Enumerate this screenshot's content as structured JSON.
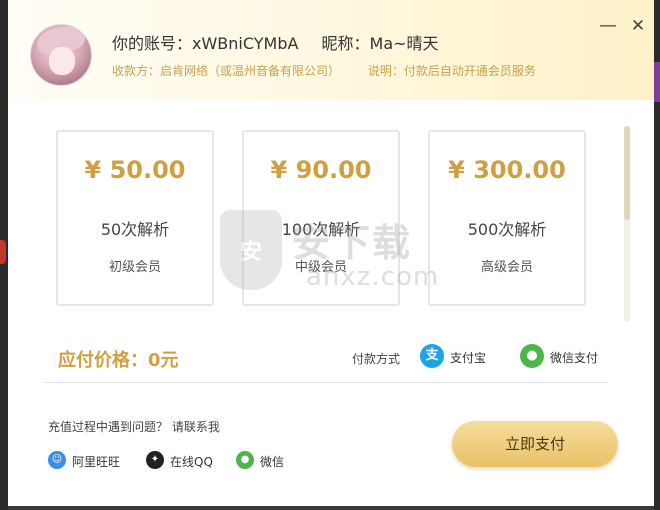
{
  "header": {
    "account_text": "你的账号：xWBniCYMbA",
    "nickname_text": "昵称：Ma~晴天",
    "payee_text": "收款方：启肯网络（或温州音备有限公司）",
    "desc_text": "说明：付款后自动开通会员服务",
    "minimize_symbol": "—",
    "close_symbol": "✕"
  },
  "plans": [
    {
      "price": "¥ 50.00",
      "count": "50次解析",
      "level": "初级会员"
    },
    {
      "price": "¥ 90.00",
      "count": "100次解析",
      "level": "中级会员"
    },
    {
      "price": "¥ 300.00",
      "count": "500次解析",
      "level": "高级会员"
    }
  ],
  "payment": {
    "amount_label": "应付价格：0元",
    "method_label": "付款方式",
    "alipay_label": "支付宝",
    "wechat_pay_label": "微信支付"
  },
  "help": {
    "text": "充值过程中遇到问题？ 请联系我",
    "contacts": [
      {
        "label": "阿里旺旺",
        "icon": "aliwangwang-icon"
      },
      {
        "label": "在线QQ",
        "icon": "qq-icon"
      },
      {
        "label": "微信",
        "icon": "wechat-icon"
      }
    ]
  },
  "pay_button": "立即支付",
  "watermark": {
    "main": "安下载",
    "sub": "anxz.com",
    "shield": "安"
  },
  "colors": {
    "gold": "#cfa042",
    "button_gold": "#e9c267",
    "alipay_blue": "#1ea3e6",
    "wechat_green": "#4cb649"
  }
}
